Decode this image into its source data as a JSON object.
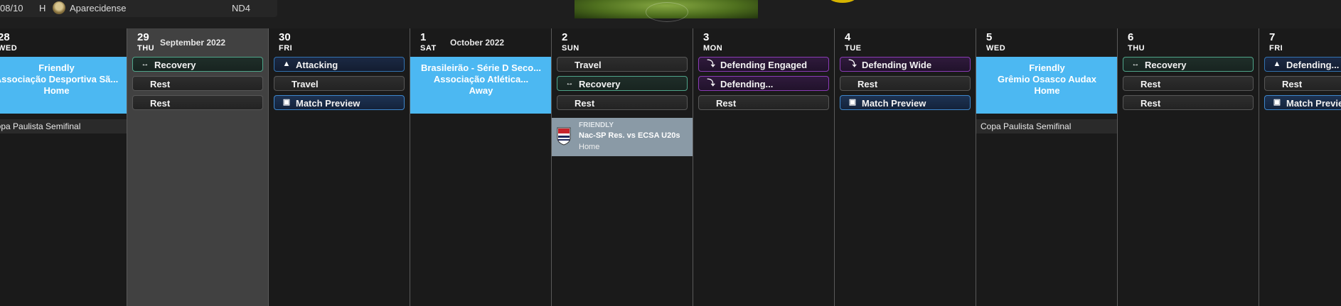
{
  "top": {
    "date": "08/10",
    "venue": "H",
    "club": "Aparecidense",
    "competition": "ND4"
  },
  "months": {
    "september": "September 2022",
    "october": "October 2022"
  },
  "days": [
    {
      "num": "28",
      "name": "WED"
    },
    {
      "num": "29",
      "name": "THU"
    },
    {
      "num": "30",
      "name": "FRI"
    },
    {
      "num": "1",
      "name": "SAT"
    },
    {
      "num": "2",
      "name": "SUN"
    },
    {
      "num": "3",
      "name": "MON"
    },
    {
      "num": "4",
      "name": "TUE"
    },
    {
      "num": "5",
      "name": "WED"
    },
    {
      "num": "6",
      "name": "THU"
    },
    {
      "num": "7",
      "name": "FRI"
    }
  ],
  "matches": {
    "wed28": {
      "l1": "Friendly",
      "l2": "Associação Desportiva Sã...",
      "l3": "Home",
      "comp": "Copa Paulista Semifinal"
    },
    "sat1": {
      "l1": "Brasileirão - Série D Seco...",
      "l2": "Associação Atlética...",
      "l3": "Away"
    },
    "wed5": {
      "l1": "Friendly",
      "l2": "Grêmio Osasco Audax",
      "l3": "Home",
      "comp": "Copa Paulista Semifinal"
    }
  },
  "sessions": {
    "thu29": [
      "Recovery",
      "Rest",
      "Rest"
    ],
    "fri30": [
      "Attacking",
      "Travel",
      "Match Preview"
    ],
    "sun2": [
      "Travel",
      "Recovery",
      "Rest"
    ],
    "mon3": [
      "Defending Engaged",
      "Defending...",
      "Rest"
    ],
    "tue4": [
      "Defending Wide",
      "Rest",
      "Match Preview"
    ],
    "thu6": [
      "Recovery",
      "Rest",
      "Rest"
    ],
    "fri7": [
      "Defending...",
      "Rest",
      "Match Preview"
    ]
  },
  "fixture": {
    "type": "FRIENDLY",
    "title": "Nac-SP Res. vs ECSA U20s",
    "venue": "Home"
  },
  "colors": {
    "match_block": "#4cb8f2",
    "recovery": "#4fa58a",
    "attacking": "#3273b2",
    "defending": "#8b3bb6",
    "fixture_block": "#8a9aa6"
  },
  "icons": {
    "recovery": "arrows-icon",
    "attacking": "attack-icon",
    "defending": "tackle-icon",
    "match_preview": "preview-icon",
    "club_badge": "club-badge-icon"
  }
}
